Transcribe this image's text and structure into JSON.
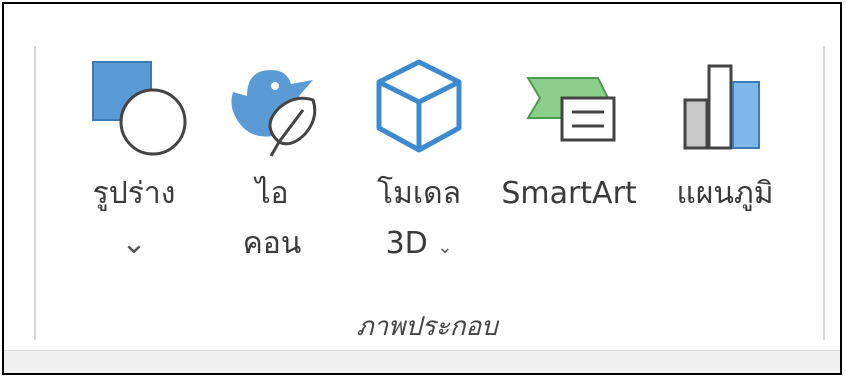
{
  "ribbon_group": {
    "label": "ภาพประกอบ",
    "buttons": [
      {
        "name": "shapes",
        "label_line1": "รูปร่าง",
        "label_line2": "",
        "dropdown": "⌄"
      },
      {
        "name": "icons",
        "label_line1": "ไอ",
        "label_line2": "คอน",
        "dropdown": ""
      },
      {
        "name": "3d-models",
        "label_line1": "โมเดล",
        "label_line2": "3D",
        "dropdown": "⌄"
      },
      {
        "name": "smartart",
        "label_line1": "SmartArt",
        "label_line2": "",
        "dropdown": ""
      },
      {
        "name": "chart",
        "label_line1": "แผนภูมิ",
        "label_line2": "",
        "dropdown": ""
      }
    ]
  },
  "colors": {
    "accent_blue": "#4a90d9",
    "accent_blue_light": "#5b9bd5",
    "smartart_green": "#8ccf8a",
    "chart_gray": "#c9c9c9",
    "frame_border": "#000000"
  },
  "icons": [
    "shapes-icon",
    "icons-icon",
    "3d-models-icon",
    "smartart-icon",
    "chart-icon"
  ]
}
